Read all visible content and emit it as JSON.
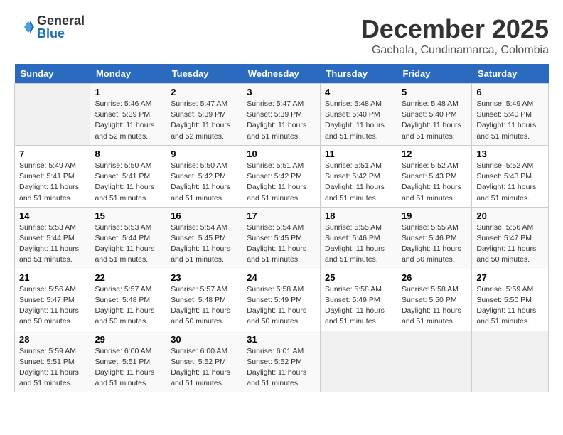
{
  "header": {
    "logo_general": "General",
    "logo_blue": "Blue",
    "month_title": "December 2025",
    "subtitle": "Gachala, Cundinamarca, Colombia"
  },
  "weekdays": [
    "Sunday",
    "Monday",
    "Tuesday",
    "Wednesday",
    "Thursday",
    "Friday",
    "Saturday"
  ],
  "weeks": [
    [
      {
        "day": "",
        "detail": ""
      },
      {
        "day": "1",
        "detail": "Sunrise: 5:46 AM\nSunset: 5:39 PM\nDaylight: 11 hours\nand 52 minutes."
      },
      {
        "day": "2",
        "detail": "Sunrise: 5:47 AM\nSunset: 5:39 PM\nDaylight: 11 hours\nand 52 minutes."
      },
      {
        "day": "3",
        "detail": "Sunrise: 5:47 AM\nSunset: 5:39 PM\nDaylight: 11 hours\nand 51 minutes."
      },
      {
        "day": "4",
        "detail": "Sunrise: 5:48 AM\nSunset: 5:40 PM\nDaylight: 11 hours\nand 51 minutes."
      },
      {
        "day": "5",
        "detail": "Sunrise: 5:48 AM\nSunset: 5:40 PM\nDaylight: 11 hours\nand 51 minutes."
      },
      {
        "day": "6",
        "detail": "Sunrise: 5:49 AM\nSunset: 5:40 PM\nDaylight: 11 hours\nand 51 minutes."
      }
    ],
    [
      {
        "day": "7",
        "detail": "Sunrise: 5:49 AM\nSunset: 5:41 PM\nDaylight: 11 hours\nand 51 minutes."
      },
      {
        "day": "8",
        "detail": "Sunrise: 5:50 AM\nSunset: 5:41 PM\nDaylight: 11 hours\nand 51 minutes."
      },
      {
        "day": "9",
        "detail": "Sunrise: 5:50 AM\nSunset: 5:42 PM\nDaylight: 11 hours\nand 51 minutes."
      },
      {
        "day": "10",
        "detail": "Sunrise: 5:51 AM\nSunset: 5:42 PM\nDaylight: 11 hours\nand 51 minutes."
      },
      {
        "day": "11",
        "detail": "Sunrise: 5:51 AM\nSunset: 5:42 PM\nDaylight: 11 hours\nand 51 minutes."
      },
      {
        "day": "12",
        "detail": "Sunrise: 5:52 AM\nSunset: 5:43 PM\nDaylight: 11 hours\nand 51 minutes."
      },
      {
        "day": "13",
        "detail": "Sunrise: 5:52 AM\nSunset: 5:43 PM\nDaylight: 11 hours\nand 51 minutes."
      }
    ],
    [
      {
        "day": "14",
        "detail": "Sunrise: 5:53 AM\nSunset: 5:44 PM\nDaylight: 11 hours\nand 51 minutes."
      },
      {
        "day": "15",
        "detail": "Sunrise: 5:53 AM\nSunset: 5:44 PM\nDaylight: 11 hours\nand 51 minutes."
      },
      {
        "day": "16",
        "detail": "Sunrise: 5:54 AM\nSunset: 5:45 PM\nDaylight: 11 hours\nand 51 minutes."
      },
      {
        "day": "17",
        "detail": "Sunrise: 5:54 AM\nSunset: 5:45 PM\nDaylight: 11 hours\nand 51 minutes."
      },
      {
        "day": "18",
        "detail": "Sunrise: 5:55 AM\nSunset: 5:46 PM\nDaylight: 11 hours\nand 51 minutes."
      },
      {
        "day": "19",
        "detail": "Sunrise: 5:55 AM\nSunset: 5:46 PM\nDaylight: 11 hours\nand 50 minutes."
      },
      {
        "day": "20",
        "detail": "Sunrise: 5:56 AM\nSunset: 5:47 PM\nDaylight: 11 hours\nand 50 minutes."
      }
    ],
    [
      {
        "day": "21",
        "detail": "Sunrise: 5:56 AM\nSunset: 5:47 PM\nDaylight: 11 hours\nand 50 minutes."
      },
      {
        "day": "22",
        "detail": "Sunrise: 5:57 AM\nSunset: 5:48 PM\nDaylight: 11 hours\nand 50 minutes."
      },
      {
        "day": "23",
        "detail": "Sunrise: 5:57 AM\nSunset: 5:48 PM\nDaylight: 11 hours\nand 50 minutes."
      },
      {
        "day": "24",
        "detail": "Sunrise: 5:58 AM\nSunset: 5:49 PM\nDaylight: 11 hours\nand 50 minutes."
      },
      {
        "day": "25",
        "detail": "Sunrise: 5:58 AM\nSunset: 5:49 PM\nDaylight: 11 hours\nand 51 minutes."
      },
      {
        "day": "26",
        "detail": "Sunrise: 5:58 AM\nSunset: 5:50 PM\nDaylight: 11 hours\nand 51 minutes."
      },
      {
        "day": "27",
        "detail": "Sunrise: 5:59 AM\nSunset: 5:50 PM\nDaylight: 11 hours\nand 51 minutes."
      }
    ],
    [
      {
        "day": "28",
        "detail": "Sunrise: 5:59 AM\nSunset: 5:51 PM\nDaylight: 11 hours\nand 51 minutes."
      },
      {
        "day": "29",
        "detail": "Sunrise: 6:00 AM\nSunset: 5:51 PM\nDaylight: 11 hours\nand 51 minutes."
      },
      {
        "day": "30",
        "detail": "Sunrise: 6:00 AM\nSunset: 5:52 PM\nDaylight: 11 hours\nand 51 minutes."
      },
      {
        "day": "31",
        "detail": "Sunrise: 6:01 AM\nSunset: 5:52 PM\nDaylight: 11 hours\nand 51 minutes."
      },
      {
        "day": "",
        "detail": ""
      },
      {
        "day": "",
        "detail": ""
      },
      {
        "day": "",
        "detail": ""
      }
    ]
  ]
}
